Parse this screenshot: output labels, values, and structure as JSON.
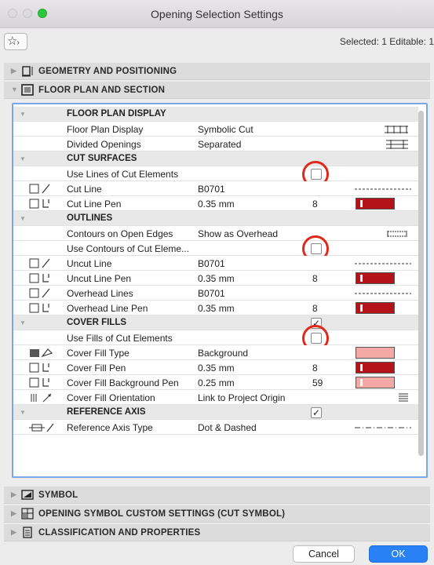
{
  "window": {
    "title": "Opening Selection Settings"
  },
  "toolbar": {
    "favorites_label": "☆",
    "selection_info": "Selected: 1 Editable: 1"
  },
  "sections": {
    "geometry": "GEOMETRY AND POSITIONING",
    "floor_plan": "FLOOR PLAN AND SECTION",
    "symbol": "SYMBOL",
    "custom": "OPENING SYMBOL CUSTOM SETTINGS (CUT SYMBOL)",
    "classification": "CLASSIFICATION AND PROPERTIES"
  },
  "rows": [
    {
      "name": "FLOOR PLAN DISPLAY",
      "sub": true
    },
    {
      "name": "Floor Plan Display",
      "value": "Symbolic Cut",
      "visual": "fp-symbol"
    },
    {
      "name": "Divided Openings",
      "value": "Separated",
      "visual": "divided-symbol"
    },
    {
      "name": "CUT SURFACES",
      "sub": true
    },
    {
      "name": "Use Lines of Cut Elements",
      "checkbox": false,
      "highlight": true
    },
    {
      "name": "Cut Line",
      "value": "B0701",
      "icon": "line-icon",
      "visual": "dashed-line"
    },
    {
      "name": "Cut Line Pen",
      "value": "0.35 mm",
      "icon": "pen-icon",
      "num": "8",
      "swatch": "#b5131a"
    },
    {
      "name": "OUTLINES",
      "sub": true
    },
    {
      "name": "Contours on Open Edges",
      "value": "Show as Overhead",
      "visual": "contour-symbol"
    },
    {
      "name": "Use Contours of Cut Eleme...",
      "checkbox": false,
      "highlight": true
    },
    {
      "name": "Uncut Line",
      "value": "B0701",
      "icon": "line-icon",
      "visual": "dashed-line"
    },
    {
      "name": "Uncut Line Pen",
      "value": "0.35 mm",
      "icon": "pen-icon",
      "num": "8",
      "swatch": "#b5131a"
    },
    {
      "name": "Overhead Lines",
      "value": "B0701",
      "icon": "line-icon",
      "visual": "dashed-line"
    },
    {
      "name": "Overhead Line Pen",
      "value": "0.35 mm",
      "icon": "pen-icon",
      "num": "8",
      "swatch": "#b5131a"
    },
    {
      "name": "COVER FILLS",
      "sub": true,
      "checkbox": true
    },
    {
      "name": "Use Fills of Cut Elements",
      "checkbox": false,
      "highlight": true
    },
    {
      "name": "Cover Fill Type",
      "value": "Background",
      "icon": "fill-icon",
      "swatch": "#f5a9a6"
    },
    {
      "name": "Cover Fill Pen",
      "value": "0.35 mm",
      "icon": "pen-icon",
      "num": "8",
      "swatch": "#b5131a"
    },
    {
      "name": "Cover Fill Background Pen",
      "value": "0.25 mm",
      "icon": "pen-icon",
      "num": "59",
      "swatch": "#f5a9a6"
    },
    {
      "name": "Cover Fill Orientation",
      "value": "Link to Project Origin",
      "icon": "orientation-icon",
      "visual": "hatch-symbol"
    },
    {
      "name": "REFERENCE AXIS",
      "sub": true,
      "checkbox": true
    },
    {
      "name": "Reference Axis Type",
      "value": "Dot & Dashed",
      "icon": "axis-icon",
      "visual": "dotdash-line"
    }
  ],
  "buttons": {
    "cancel": "Cancel",
    "ok": "OK"
  },
  "colors": {
    "accent": "#2a80f5",
    "highlight_ring": "#e0281b",
    "pen_red": "#b5131a",
    "fill_pink": "#f5a9a6"
  }
}
